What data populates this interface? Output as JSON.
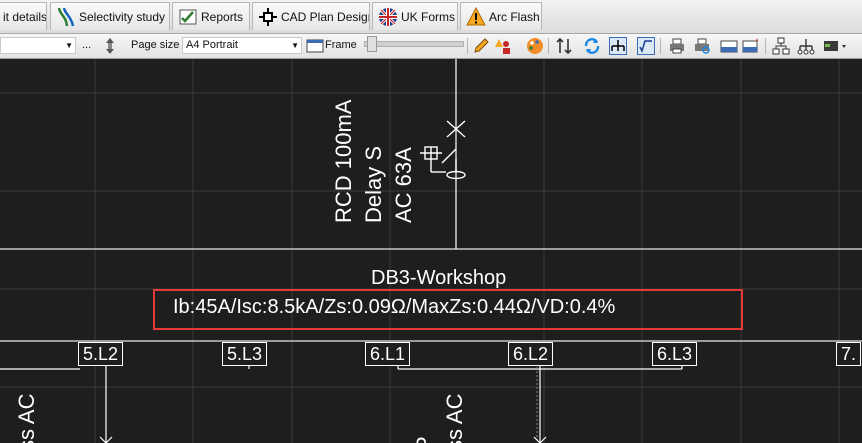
{
  "tabs": [
    {
      "label": "it details",
      "icon": "circuit-details-icon"
    },
    {
      "label": "Selectivity study",
      "icon": "selectivity-curves-icon"
    },
    {
      "label": "Reports",
      "icon": "reports-icon"
    },
    {
      "label": "CAD Plan Design",
      "icon": "cad-crosshair-icon"
    },
    {
      "label": "UK Forms",
      "icon": "uk-flag-icon"
    },
    {
      "label": "Arc Flash",
      "icon": "arc-flash-warning-icon"
    }
  ],
  "toolbar": {
    "ellipsis": "...",
    "page_size_label": "Page size",
    "page_size_value": "A4 Portrait",
    "frame_label": "Frame"
  },
  "diagram": {
    "device_label_lines": [
      "RCD 100mA",
      "Delay S",
      "AC 63A"
    ],
    "board_name": "DB3-Workshop",
    "board_info": "Ib:45A/Isc:8.5kA/Zs:0.09Ω/MaxZs:0.44Ω/VD:0.4%",
    "ways": [
      "5.L2",
      "5.L3",
      "6.L1",
      "6.L2",
      "6.L3",
      "7."
    ],
    "bottom_labels": [
      "ss AC",
      "ss AC",
      "P"
    ],
    "highlight_color": "#e53935"
  }
}
